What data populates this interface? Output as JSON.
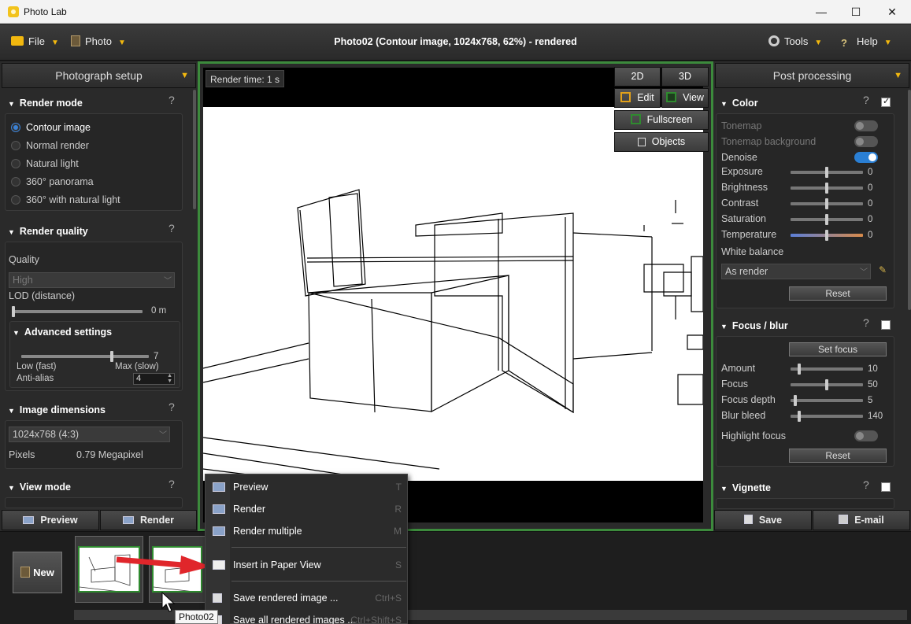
{
  "window": {
    "title": "Photo Lab",
    "controls": {
      "minimize": "—",
      "maximize": "☐",
      "close": "✕"
    }
  },
  "menubar": {
    "file": "File",
    "photo": "Photo",
    "document_title": "Photo02 (Contour image, 1024x768, 62%) - rendered",
    "tools": "Tools",
    "help": "Help"
  },
  "left_panel": {
    "header": "Photograph setup",
    "render_mode": {
      "title": "Render mode",
      "options": [
        "Contour image",
        "Normal render",
        "Natural light",
        "360° panorama",
        "360° with natural light"
      ],
      "selected": "Contour image"
    },
    "render_quality": {
      "title": "Render quality",
      "quality_label": "Quality",
      "quality_value": "High",
      "lod_label": "LOD (distance)",
      "lod_value": "0 m",
      "lod_level": 0.0,
      "advanced": {
        "title": "Advanced settings",
        "slider_value": "7",
        "slider_level": 0.7,
        "low_label": "Low (fast)",
        "max_label": "Max (slow)",
        "antialias_label": "Anti-alias",
        "antialias_value": "4"
      }
    },
    "image_dimensions": {
      "title": "Image dimensions",
      "value": "1024x768 (4:3)",
      "pixels_label": "Pixels",
      "pixels_value": "0.79 Megapixel"
    },
    "view_mode": {
      "title": "View mode"
    },
    "help_mark": "?",
    "preview_button": "Preview",
    "render_button": "Render"
  },
  "viewport": {
    "render_time": "Render time: 1 s",
    "btn_2d": "2D",
    "btn_3d": "3D",
    "btn_edit": "Edit",
    "btn_view": "View",
    "btn_fullscreen": "Fullscreen",
    "btn_objects": "Objects",
    "accent_color": "#3c8a3c"
  },
  "right_panel": {
    "header": "Post processing",
    "color": {
      "title": "Color",
      "checked": true,
      "tonemap": "Tonemap",
      "tonemap_bg": "Tonemap background",
      "denoise": "Denoise",
      "sliders": [
        {
          "label": "Exposure",
          "value": "0",
          "level": 0.5
        },
        {
          "label": "Brightness",
          "value": "0",
          "level": 0.5
        },
        {
          "label": "Contrast",
          "value": "0",
          "level": 0.5
        },
        {
          "label": "Saturation",
          "value": "0",
          "level": 0.5
        },
        {
          "label": "Temperature",
          "value": "0",
          "level": 0.5
        }
      ],
      "white_balance_label": "White balance",
      "white_balance_value": "As render",
      "reset": "Reset"
    },
    "focus": {
      "title": "Focus / blur",
      "set_focus": "Set focus",
      "sliders": [
        {
          "label": "Amount",
          "value": "10",
          "level": 0.1
        },
        {
          "label": "Focus",
          "value": "50",
          "level": 0.5
        },
        {
          "label": "Focus depth",
          "value": "5",
          "level": 0.05
        },
        {
          "label": "Blur bleed",
          "value": "140",
          "level": 0.1
        }
      ],
      "highlight_focus": "Highlight focus",
      "reset": "Reset"
    },
    "vignette": {
      "title": "Vignette"
    },
    "help_mark": "?",
    "save_button": "Save",
    "email_button": "E-mail"
  },
  "bottom": {
    "new_button": "New",
    "tooltip": "Photo02"
  },
  "context_menu": {
    "items": [
      {
        "label": "Preview",
        "key": "T"
      },
      {
        "label": "Render",
        "key": "R"
      },
      {
        "label": "Render multiple",
        "key": "M"
      },
      {
        "label": "Insert in Paper View",
        "key": "S"
      },
      {
        "label": "Save rendered image ...",
        "key": "Ctrl+S"
      },
      {
        "label": "Save all rendered images ...",
        "key": "Ctrl+Shift+S"
      }
    ]
  },
  "colors": {
    "accent_orange": "#f2b80f",
    "toggle_on": "#2a7fd4",
    "arrow_red": "#e0262b"
  }
}
